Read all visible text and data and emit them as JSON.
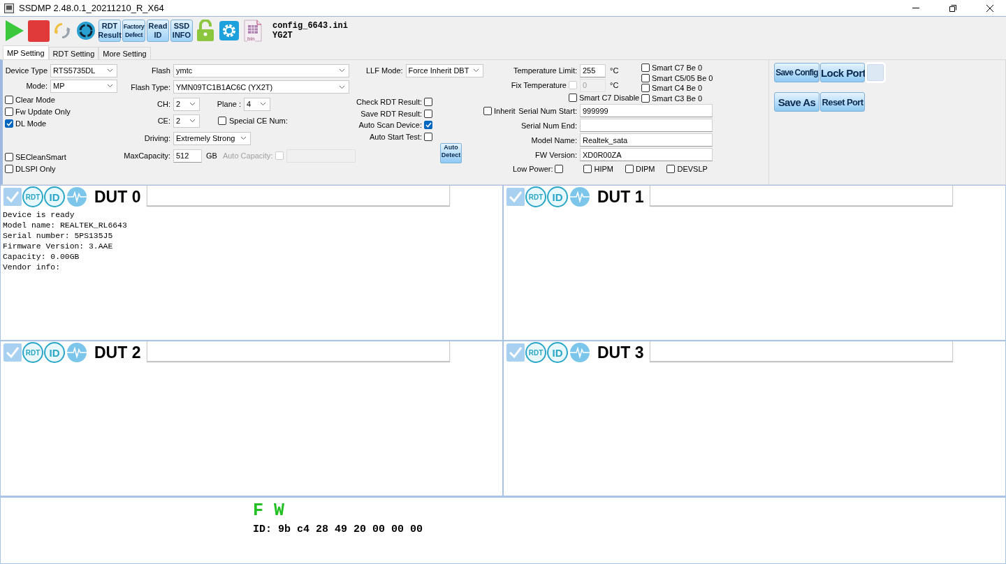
{
  "window": {
    "title": "SSDMP 2.48.0.1_20211210_R_X64"
  },
  "toolbar": {
    "buttons": [
      {
        "kind": "play"
      },
      {
        "kind": "stop"
      },
      {
        "kind": "refresh"
      },
      {
        "kind": "recycle"
      },
      {
        "kind": "text",
        "lines": [
          "RDT",
          "Result"
        ]
      },
      {
        "kind": "text",
        "lines": [
          "Factory",
          "Defect"
        ],
        "narrow": true
      },
      {
        "kind": "text",
        "lines": [
          "Read",
          "ID"
        ]
      },
      {
        "kind": "text",
        "lines": [
          "SSD",
          "INFO"
        ]
      },
      {
        "kind": "lock"
      },
      {
        "kind": "gear"
      },
      {
        "kind": "file",
        "label": "bin"
      }
    ],
    "config_file": "config_6643.ini",
    "flash_code": "YG2T"
  },
  "tabs": [
    {
      "label": "MP Setting",
      "selected": true
    },
    {
      "label": "RDT Setting",
      "selected": false
    },
    {
      "label": "More Setting",
      "selected": false
    }
  ],
  "mp_setting": {
    "device_type": {
      "label": "Device Type",
      "value": "RTS5735DL"
    },
    "mode": {
      "label": "Mode:",
      "value": "MP"
    },
    "options": [
      {
        "label": "Clear Mode",
        "checked": false
      },
      {
        "label": "Fw Update Only",
        "checked": false
      },
      {
        "label": "DL Mode",
        "checked": true
      }
    ],
    "options_2": [
      {
        "label": "SECleanSmart",
        "checked": false
      },
      {
        "label": "DLSPI Only",
        "checked": false
      }
    ],
    "flash": {
      "label": "Flash",
      "value": "ymtc"
    },
    "flash_type": {
      "label": "Flash Type:",
      "value": "YMN09TC1B1AC6C (YX2T)"
    },
    "ch": {
      "label": "CH:",
      "value": "2"
    },
    "plane": {
      "label": "Plane :",
      "value": "4"
    },
    "ce": {
      "label": "CE:",
      "value": "2"
    },
    "special_ce": {
      "label": "Special CE Num:",
      "checked": false
    },
    "driving": {
      "label": "Driving:",
      "value": "Extremely Strong"
    },
    "max_capacity": {
      "label": "MaxCapacity:",
      "value": "512",
      "unit": "GB"
    },
    "auto_capacity": {
      "label": "Auto Capacity:",
      "checked": false,
      "disabled": true
    },
    "llf_mode": {
      "label": "LLF Mode:",
      "value": "Force Inherit DBT"
    },
    "rdt_options": [
      {
        "label": "Check RDT Result:",
        "checked": false
      },
      {
        "label": "Save RDT Result:",
        "checked": false
      },
      {
        "label": "Auto Scan Device:",
        "checked": true
      },
      {
        "label": "Auto Start Test:",
        "checked": false
      }
    ],
    "auto_detect": [
      "Auto",
      "Detect"
    ],
    "temperature_limit": {
      "label": "Temperature Limit:",
      "value": "255",
      "unit": "°C"
    },
    "fix_temperature": {
      "label": "Fix Temperature",
      "checked": false,
      "value": "0",
      "unit": "°C",
      "disabled": true
    },
    "smart_c7_disable": {
      "label": "Smart C7 Disable",
      "checked": false
    },
    "smart_options": [
      {
        "label": "Smart C7 Be 0",
        "checked": false
      },
      {
        "label": "Smart C5/05 Be 0",
        "checked": false
      },
      {
        "label": "Smart C4 Be 0",
        "checked": false
      },
      {
        "label": "Smart C3 Be 0",
        "checked": false
      }
    ],
    "inherit": {
      "label": "Inherit",
      "checked": false
    },
    "serial_fields": [
      {
        "label": "Serial Num Start:",
        "value": "999999"
      },
      {
        "label": "Serial Num End:"
      },
      {
        "label": "Model Name:",
        "value": "Realtek_sata"
      },
      {
        "label": "FW Version:",
        "value": "XD0R00ZA"
      }
    ],
    "low_power": {
      "label": "Low Power:",
      "checked": false
    },
    "power_options": [
      {
        "label": "HIPM",
        "checked": false
      },
      {
        "label": "DIPM",
        "checked": false
      },
      {
        "label": "DEVSLP",
        "checked": false
      }
    ],
    "port_buttons": [
      {
        "label": "Save Config"
      },
      {
        "label": "Lock Port"
      },
      {
        "label": "Save As"
      },
      {
        "label": "Reset Port"
      }
    ]
  },
  "duts": [
    {
      "title": "DUT 0",
      "checked": true,
      "rdt_label": "RDT",
      "id_label": "ID",
      "log": [
        "Device is ready",
        "Model name: REALTEK_RL6643",
        "Serial number: 5PS135J5",
        "Firmware Version: 3.AAE",
        "Capacity: 0.00GB",
        "Vendor info:"
      ]
    },
    {
      "title": "DUT 1",
      "checked": true,
      "rdt_label": "RDT",
      "id_label": "ID"
    },
    {
      "title": "DUT 2",
      "checked": true,
      "rdt_label": "RDT",
      "id_label": "ID"
    },
    {
      "title": "DUT 3",
      "checked": true,
      "rdt_label": "RDT",
      "id_label": "ID"
    }
  ],
  "result": {
    "flags": "F W",
    "id_line": "ID: 9b c4 28 49 20 00 00 00"
  }
}
